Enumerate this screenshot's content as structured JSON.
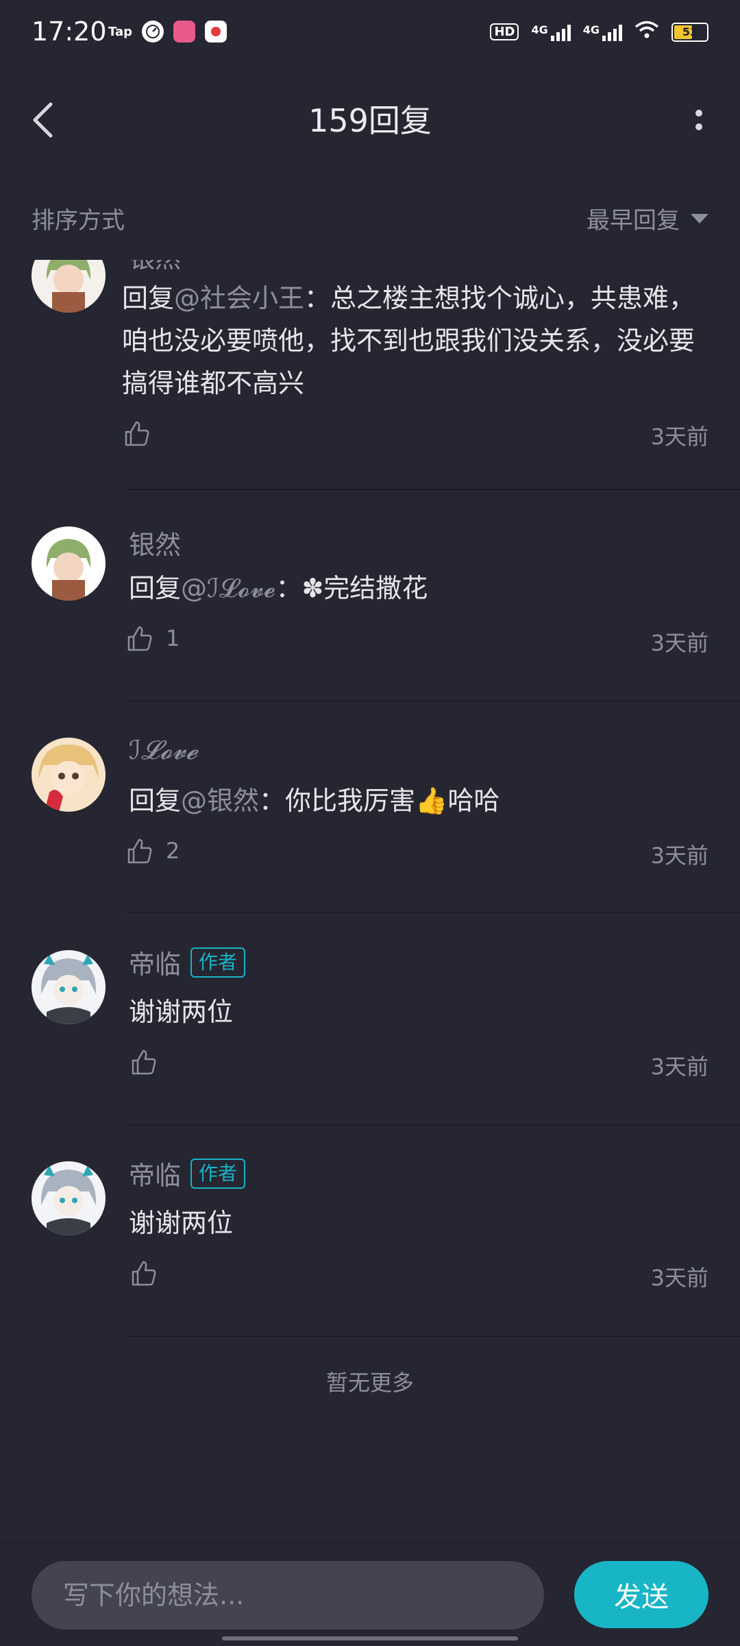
{
  "status_bar": {
    "time": "17:20",
    "apps": [
      "Tap",
      "",
      "",
      ""
    ],
    "network": [
      "4G",
      "4G"
    ],
    "hd": "HD",
    "battery": "53"
  },
  "header": {
    "title": "159回复"
  },
  "sort": {
    "label": "排序方式",
    "selected": "最早回复"
  },
  "comments": [
    {
      "author": "银然",
      "reply_prefix": "回复",
      "mention": "@社会小王",
      "text": "：总之楼主想找个诚心，共患难，咱也没必要喷他，找不到也跟我们没关系，没必要搞得谁都不高兴",
      "likes": "",
      "time": "3天前",
      "badge": ""
    },
    {
      "author": "银然",
      "reply_prefix": "回复",
      "mention": "@ℐ𝓛𝓸𝓿𝓮",
      "text": "：✽完结撒花",
      "likes": "1",
      "time": "3天前",
      "badge": ""
    },
    {
      "author": "ℐ𝓛𝓸𝓿𝓮",
      "reply_prefix": "回复",
      "mention": "@银然",
      "text": "：你比我厉害👍哈哈",
      "likes": "2",
      "time": "3天前",
      "badge": ""
    },
    {
      "author": "帝临",
      "reply_prefix": "",
      "mention": "",
      "text": "谢谢两位",
      "likes": "",
      "time": "3天前",
      "badge": "作者"
    },
    {
      "author": "帝临",
      "reply_prefix": "",
      "mention": "",
      "text": "谢谢两位",
      "likes": "",
      "time": "3天前",
      "badge": "作者"
    }
  ],
  "footer_text": "暂无更多",
  "composer": {
    "placeholder": "写下你的想法...",
    "send_label": "发送"
  },
  "colors": {
    "background": "#252631",
    "accent": "#18b5c6",
    "muted": "#8d8f9c"
  }
}
